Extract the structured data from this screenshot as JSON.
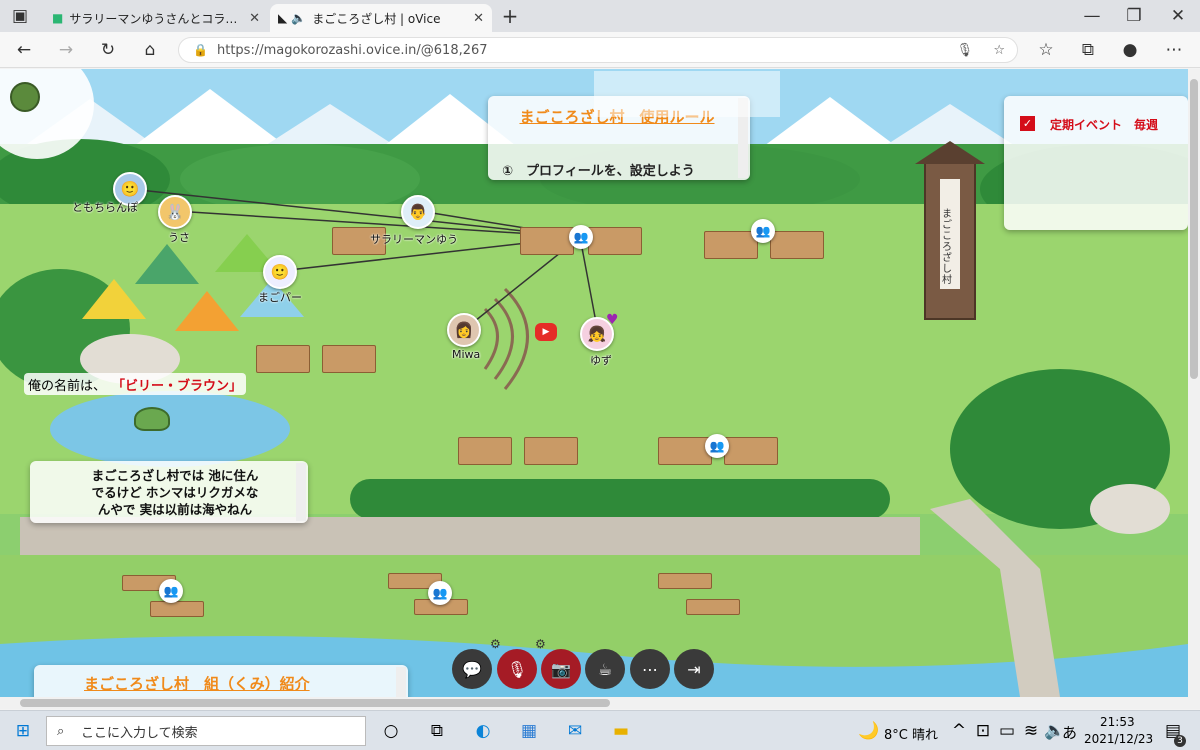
{
  "browser": {
    "tabs": [
      {
        "title": "サラリーマンゆうさんとコラボ配信をす",
        "active": false
      },
      {
        "title": "まごころざし村 | oVice",
        "active": true
      }
    ],
    "url": "https://magokorozashi.ovice.in/@618,267",
    "colors": {
      "tabbar": "#dfe1e5",
      "active_tab": "#f7f7f7"
    }
  },
  "rules_panel": {
    "title": "まごころざし村　使用ルール",
    "item": "①　プロフィールを、設定しよう"
  },
  "event_panel": {
    "label": "定期イベント　毎週"
  },
  "name_banner": {
    "prefix": "俺の名前は、",
    "name": "「ビリー・ブラウン」"
  },
  "turtle_panel": {
    "text": "まごころざし村では 池に住んでるけど ホンマはリクガメなんやで 実は以前は海やねん"
  },
  "bottom_panel": {
    "title": "まごころざし村　組（くみ）紹介"
  },
  "tower_sign": "まごころざし村",
  "avatars": [
    {
      "name": "ともちらんぽ"
    },
    {
      "name": "うさ"
    },
    {
      "name": "サラリーマンゆう"
    },
    {
      "name": "まごパー"
    },
    {
      "name": "Miwa"
    },
    {
      "name": "ゆず"
    }
  ],
  "controls": [
    "chat",
    "mic-off",
    "camera-off",
    "coffee",
    "more",
    "exit"
  ],
  "taskbar": {
    "search_placeholder": "ここに入力して検索",
    "weather": "8°C 晴れ",
    "ime": "あ",
    "time": "21:53",
    "date": "2021/12/23",
    "notifications": "3"
  }
}
